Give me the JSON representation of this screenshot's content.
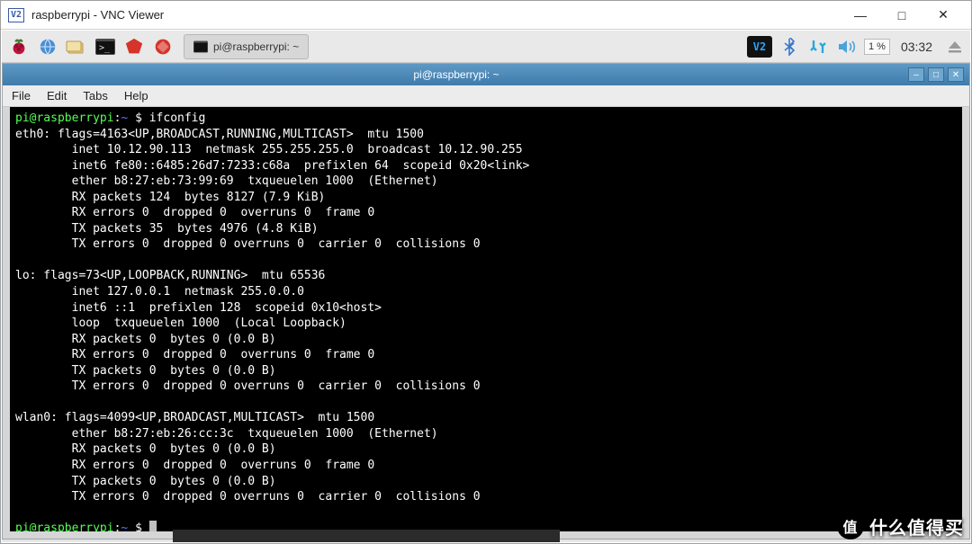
{
  "vnc": {
    "title": "raspberrypi - VNC Viewer",
    "logo": "V2"
  },
  "taskbar": {
    "tooltip": "Mathematica",
    "task_button_label": "pi@raspberrypi: ~",
    "cpu_percent": "1 %",
    "clock": "03:32",
    "vnc_badge": "V2"
  },
  "terminal": {
    "title": "pi@raspberrypi: ~",
    "menus": {
      "file": "File",
      "edit": "Edit",
      "tabs": "Tabs",
      "help": "Help"
    },
    "prompt_user": "pi@raspberrypi",
    "prompt_sep": ":",
    "prompt_path": "~",
    "prompt_sym": "$",
    "command1": "ifconfig",
    "output_lines": [
      "eth0: flags=4163<UP,BROADCAST,RUNNING,MULTICAST>  mtu 1500",
      "        inet 10.12.90.113  netmask 255.255.255.0  broadcast 10.12.90.255",
      "        inet6 fe80::6485:26d7:7233:c68a  prefixlen 64  scopeid 0x20<link>",
      "        ether b8:27:eb:73:99:69  txqueuelen 1000  (Ethernet)",
      "        RX packets 124  bytes 8127 (7.9 KiB)",
      "        RX errors 0  dropped 0  overruns 0  frame 0",
      "        TX packets 35  bytes 4976 (4.8 KiB)",
      "        TX errors 0  dropped 0 overruns 0  carrier 0  collisions 0",
      "",
      "lo: flags=73<UP,LOOPBACK,RUNNING>  mtu 65536",
      "        inet 127.0.0.1  netmask 255.0.0.0",
      "        inet6 ::1  prefixlen 128  scopeid 0x10<host>",
      "        loop  txqueuelen 1000  (Local Loopback)",
      "        RX packets 0  bytes 0 (0.0 B)",
      "        RX errors 0  dropped 0  overruns 0  frame 0",
      "        TX packets 0  bytes 0 (0.0 B)",
      "        TX errors 0  dropped 0 overruns 0  carrier 0  collisions 0",
      "",
      "wlan0: flags=4099<UP,BROADCAST,MULTICAST>  mtu 1500",
      "        ether b8:27:eb:26:cc:3c  txqueuelen 1000  (Ethernet)",
      "        RX packets 0  bytes 0 (0.0 B)",
      "        RX errors 0  dropped 0  overruns 0  frame 0",
      "        TX packets 0  bytes 0 (0.0 B)",
      "        TX errors 0  dropped 0 overruns 0  carrier 0  collisions 0",
      ""
    ]
  },
  "watermark": {
    "text": "什么值得买",
    "badge": "值"
  }
}
